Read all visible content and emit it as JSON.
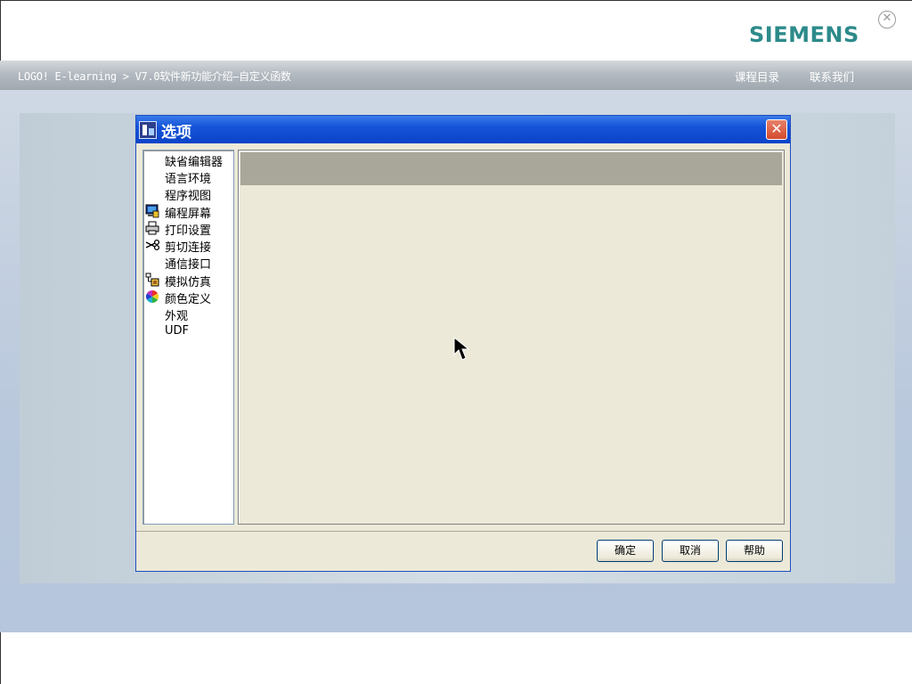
{
  "header": {
    "brand": "SIEMENS",
    "close_icon": "circle-x-icon"
  },
  "nav": {
    "breadcrumb": "LOGO! E-learning > V7.0软件新功能介绍—自定义函数",
    "links": [
      "课程目录",
      "联系我们"
    ]
  },
  "dialog": {
    "title": "选项",
    "tree_items": [
      {
        "label": "缺省编辑器",
        "icon": ""
      },
      {
        "label": "语言环境",
        "icon": ""
      },
      {
        "label": "程序视图",
        "icon": ""
      },
      {
        "label": "编程屏幕",
        "icon": "monitor-icon"
      },
      {
        "label": "打印设置",
        "icon": "printer-icon"
      },
      {
        "label": "剪切连接",
        "icon": "scissors-icon"
      },
      {
        "label": "通信接口",
        "icon": ""
      },
      {
        "label": "模拟仿真",
        "icon": "simulation-icon"
      },
      {
        "label": "颜色定义",
        "icon": "color-wheel-icon"
      },
      {
        "label": "外观",
        "icon": ""
      },
      {
        "label": "UDF",
        "icon": ""
      }
    ],
    "buttons": {
      "ok": "确定",
      "cancel": "取消",
      "help": "帮助"
    }
  }
}
